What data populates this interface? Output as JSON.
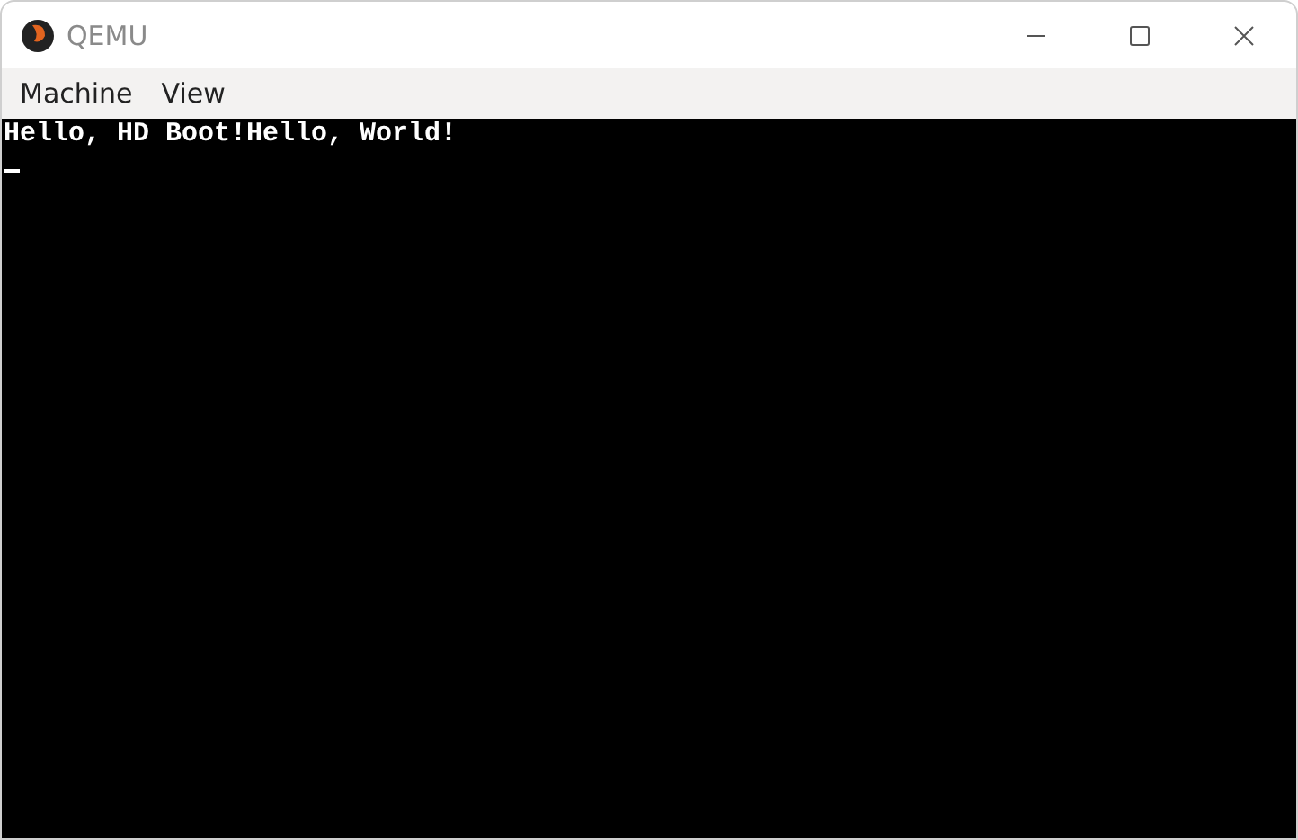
{
  "window": {
    "title": "QEMU"
  },
  "menu": [
    {
      "label": "Machine"
    },
    {
      "label": "View"
    }
  ],
  "console": {
    "lines": [
      "Hello, HD Boot!Hello, World!"
    ],
    "cursor": true
  }
}
